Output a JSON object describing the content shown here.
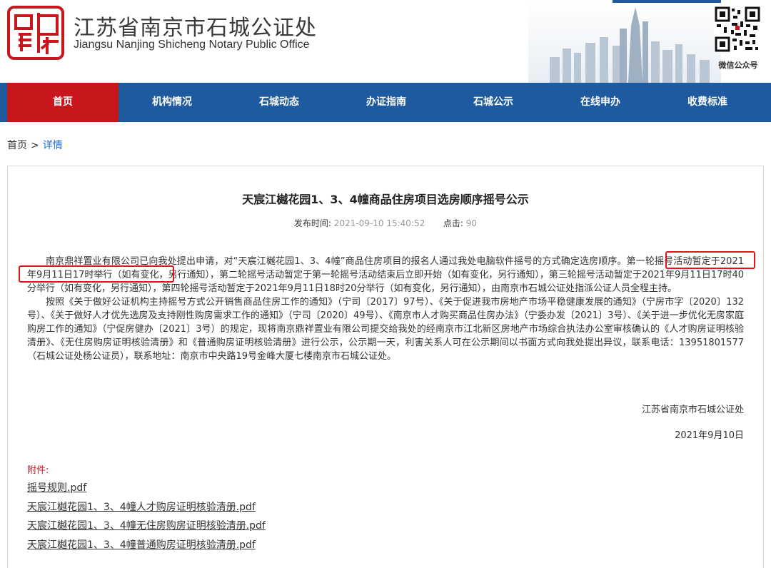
{
  "header": {
    "org_name_cn": "江苏省南京市石城公证处",
    "org_name_en": "Jiangsu Nanjing Shicheng Notary Public Office",
    "qr_label": "微信公众号",
    "seal_icon": "notary-seal-icon",
    "brand_red": "#c8161d"
  },
  "nav": {
    "items": [
      {
        "label": "首页",
        "active": true
      },
      {
        "label": "机构情况"
      },
      {
        "label": "石城动态"
      },
      {
        "label": "办证指南"
      },
      {
        "label": "石城公示"
      },
      {
        "label": "在线申办"
      },
      {
        "label": "收费标准"
      }
    ],
    "bg_color": "#1d5aa0",
    "active_color": "#c8161d"
  },
  "breadcrumb": {
    "home": "首页",
    "separator": ">",
    "current": "详情"
  },
  "article": {
    "title": "天宸江樾花园1、3、4幢商品住房项目选房顺序摇号公示",
    "publish_label": "发布时间:",
    "publish_time": "2021-09-10 15:40:52",
    "clicks_label": "点击:",
    "clicks": "90",
    "paragraph1": "南京鼎祥置业有限公司已向我处提出申请，对“天宸江樾花园1、3、4幢”商品住房项目的报名人通过我处电脑软件摇号的方式确定选房顺序。第一轮摇号活动暂定于2021年9月11日17时举行（如有变化，另行通知），第二轮摇号活动暂定于第一轮摇号活动结束后立即开始（如有变化，另行通知），第三轮摇号活动暂定于2021年9月11日17时40分举行（如有变化，另行通知），第四轮摇号活动暂定于2021年9月11日18时20分举行（如有变化，另行通知），由南京市石城公证处指派公证人员全程主持。",
    "paragraph2": "按照《关于做好公证机构主持摇号方式公开销售商品住房工作的通知》（宁司〔2017〕97号）、《关于促进我市房地产市场平稳健康发展的通知》（宁房市字〔2020〕132号）、《关于做好人才优先选房及支持刚性购房需求工作的通知》（宁司〔2020〕49号）、《南京市人才购买商品住房办法》（宁委办发〔2021〕3号）、《关于进一步优化无房家庭购房工作的通知》（宁促房健办〔2021〕3号）的规定，现将南京鼎祥置业有限公司提交给我处的经南京市江北新区房地产市场综合执法办公室审核确认的《人才购房证明核验清册》、《无住房购房证明核验清册》和《普通购房证明核验清册》进行公示，公示期一天，利害关系人可在公示期间以书面方式向我处提出异议，联系电话：13951801577（石城公证处杨公证员），联系地址：南京市中央路19号金峰大厦七楼南京市石城公证处。",
    "signer": "江苏省南京市石城公证处",
    "sign_date": "2021年9月10日",
    "highlight_color": "#e0151b"
  },
  "attachments": {
    "label": "附件:",
    "files": [
      "摇号规则.pdf",
      "天宸江樾花园1、3、4幢人才购房证明核验清册.pdf",
      "天宸江樾花园1、3、4幢无住房购房证明核验清册.pdf",
      "天宸江樾花园1、3、4幢普通购房证明核验清册.pdf"
    ]
  }
}
